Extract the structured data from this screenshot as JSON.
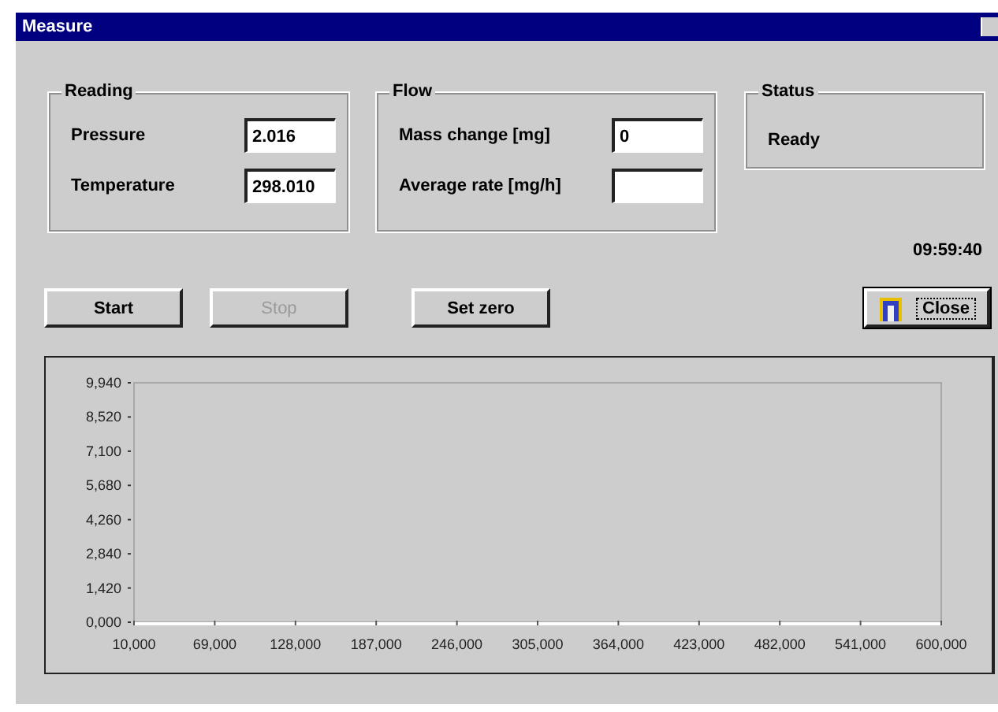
{
  "window": {
    "title": "Measure"
  },
  "groups": [
    {
      "title": "Reading",
      "fields": [
        {
          "label": "Pressure",
          "value": "2.016"
        },
        {
          "label": "Temperature",
          "value": "298.010"
        }
      ]
    },
    {
      "title": "Flow",
      "fields": [
        {
          "label": "Mass change [mg]",
          "value": "0"
        },
        {
          "label": "Average rate [mg/h]"
        }
      ]
    }
  ],
  "status": {
    "title": "Status",
    "text": "Ready"
  },
  "clock": "09:59:40",
  "buttons": [
    {
      "label": "Start",
      "disabled": false,
      "kind": "plain"
    },
    {
      "label": "Stop",
      "disabled": true,
      "kind": "plain"
    },
    {
      "label": "Set zero",
      "disabled": false,
      "kind": "plain"
    },
    {
      "label": "Close",
      "disabled": false,
      "kind": "default"
    }
  ],
  "chart": {
    "chart_data": {
      "type": "line",
      "xlim": [
        10000,
        600000
      ],
      "ylim": [
        0,
        9940
      ],
      "xticks": [
        {
          "value": 10000,
          "label": "10,000"
        },
        {
          "value": 69000,
          "label": "69,000"
        },
        {
          "value": 128000,
          "label": "128,000"
        },
        {
          "value": 187000,
          "label": "187,000"
        },
        {
          "value": 246000,
          "label": "246,000"
        },
        {
          "value": 305000,
          "label": "305,000"
        },
        {
          "value": 364000,
          "label": "364,000"
        },
        {
          "value": 423000,
          "label": "423,000"
        },
        {
          "value": 482000,
          "label": "482,000"
        },
        {
          "value": 541000,
          "label": "541,000"
        },
        {
          "value": 600000,
          "label": "600,000"
        }
      ],
      "yticks": [
        {
          "value": 0,
          "label": "0,000"
        },
        {
          "value": 1420,
          "label": "1,420"
        },
        {
          "value": 2840,
          "label": "2,840"
        },
        {
          "value": 4260,
          "label": "4,260"
        },
        {
          "value": 5680,
          "label": "5,680"
        },
        {
          "value": 7100,
          "label": "7,100"
        },
        {
          "value": 8520,
          "label": "8,520"
        },
        {
          "value": 9940,
          "label": "9,940"
        }
      ]
    }
  }
}
